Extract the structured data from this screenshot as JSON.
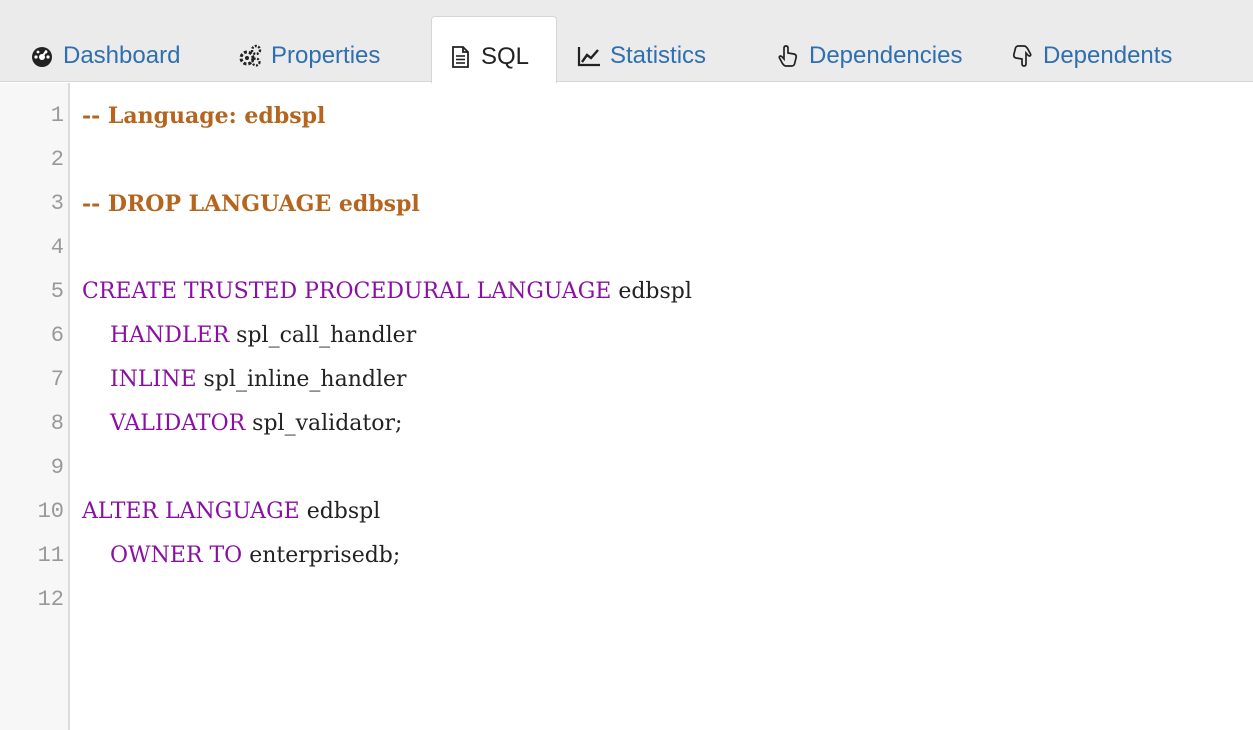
{
  "tabs": [
    {
      "label": "Dashboard",
      "icon": "dashboard-icon",
      "active": false
    },
    {
      "label": "Properties",
      "icon": "cogs-icon",
      "active": false
    },
    {
      "label": "SQL",
      "icon": "file-text-icon",
      "active": true
    },
    {
      "label": "Statistics",
      "icon": "line-chart-icon",
      "active": false
    },
    {
      "label": "Dependencies",
      "icon": "hand-up-icon",
      "active": false
    },
    {
      "label": "Dependents",
      "icon": "hand-down-icon",
      "active": false
    }
  ],
  "editor": {
    "lines": [
      {
        "num": "1",
        "comment": "-- Language: edbspl"
      },
      {
        "num": "2"
      },
      {
        "num": "3",
        "comment": "-- DROP LANGUAGE edbspl"
      },
      {
        "num": "4"
      },
      {
        "num": "5",
        "keyword": "CREATE TRUSTED PROCEDURAL LANGUAGE",
        "text": " edbspl"
      },
      {
        "num": "6",
        "indent": "    ",
        "keyword": "HANDLER",
        "text": " spl_call_handler"
      },
      {
        "num": "7",
        "indent": "    ",
        "keyword": "INLINE",
        "text": " spl_inline_handler"
      },
      {
        "num": "8",
        "indent": "    ",
        "keyword": "VALIDATOR",
        "text": " spl_validator;"
      },
      {
        "num": "9"
      },
      {
        "num": "10",
        "keyword": "ALTER LANGUAGE",
        "text": " edbspl"
      },
      {
        "num": "11",
        "indent": "    ",
        "keyword": "OWNER TO",
        "text": " enterprisedb;"
      },
      {
        "num": "12"
      }
    ]
  },
  "colors": {
    "link": "#2f6fb0",
    "comment": "#b5651d",
    "keyword": "#8b0fa5"
  }
}
